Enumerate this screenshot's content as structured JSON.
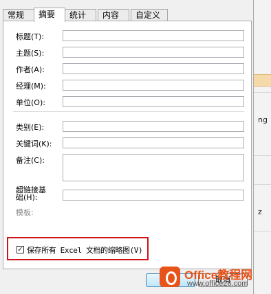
{
  "tabs": [
    {
      "label": "常规",
      "active": false
    },
    {
      "label": "摘要",
      "active": true
    },
    {
      "label": "统计",
      "active": false
    },
    {
      "label": "内容",
      "active": false
    },
    {
      "label": "自定义",
      "active": false
    }
  ],
  "fields": {
    "title": {
      "label": "标题(T):",
      "value": ""
    },
    "subject": {
      "label": "主题(S):",
      "value": ""
    },
    "author": {
      "label": "作者(A):",
      "value": ""
    },
    "manager": {
      "label": "经理(M):",
      "value": ""
    },
    "company": {
      "label": "单位(O):",
      "value": ""
    },
    "category": {
      "label": "类别(E):",
      "value": ""
    },
    "keywords": {
      "label": "关键词(K):",
      "value": ""
    },
    "comments": {
      "label": "备注(C):",
      "value": ""
    },
    "hyperlink_base": {
      "label": "超链接基础(H):",
      "value": ""
    },
    "template": {
      "label": "模板:"
    }
  },
  "thumbnail_option": {
    "label": "保存所有 Excel 文档的缩略图(V)",
    "checked": true
  },
  "buttons": {
    "ok": "",
    "cancel": "取消"
  },
  "background": {
    "fragments": [
      "ng",
      "z"
    ]
  },
  "watermark": {
    "line1": "Office教程网",
    "line2": "www.office26.com"
  },
  "colors": {
    "highlight_border": "#d0111a",
    "watermark": "#e8531a"
  }
}
